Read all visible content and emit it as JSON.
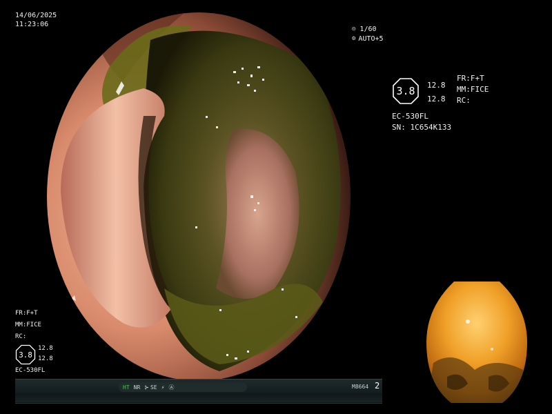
{
  "datetime": {
    "date": "14/06/2025",
    "time": "11:23:06"
  },
  "exposure": {
    "shutter": "1/60",
    "auto": "AUTO+5"
  },
  "right_panel": {
    "badge": "3.8",
    "value_top": "12.8",
    "value_bottom": "12.8",
    "fr": "FR:F+T",
    "mm": "MM:FICE",
    "rc": "RC:",
    "scope_model": "EC-530FL",
    "serial": "SN: 1C654K133"
  },
  "left_panel": {
    "fr": "FR:F+T",
    "mm": "MM:FICE",
    "rc": "RC:",
    "badge": "3.8",
    "value_top": "12.8",
    "value_bottom": "12.8",
    "scope_model": "EC-530FL"
  },
  "status_bar": {
    "ht": "HT",
    "nr": "NR",
    "se": "SE",
    "model_code": "M8664",
    "page": "2"
  },
  "colors": {
    "status_on": "#37d43a",
    "osd_text": "#f2f2f2"
  }
}
